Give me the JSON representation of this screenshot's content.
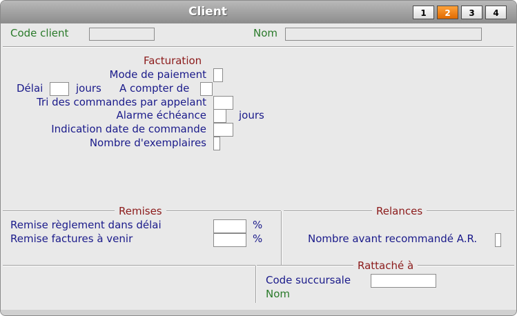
{
  "window": {
    "title": "Client"
  },
  "tabs": [
    {
      "label": "1",
      "active": false
    },
    {
      "label": "2",
      "active": true
    },
    {
      "label": "3",
      "active": false
    },
    {
      "label": "4",
      "active": false
    }
  ],
  "header": {
    "code_client_label": "Code client",
    "nom_label": "Nom",
    "code_client_value": "",
    "nom_value": ""
  },
  "facturation": {
    "title": "Facturation",
    "mode_paiement_label": "Mode de paiement",
    "delai_label": "Délai",
    "jours_label": "jours",
    "a_compter_label": "A compter de",
    "tri_commandes_label": "Tri des commandes par appelant",
    "alarme_label": "Alarme échéance",
    "alarme_jours_label": "jours",
    "indication_label": "Indication date de commande",
    "exemplaires_label": "Nombre d'exemplaires"
  },
  "remises": {
    "title": "Remises",
    "reglement_label": "Remise règlement dans délai",
    "factures_label": "Remise factures à venir",
    "percent_1": "%",
    "percent_2": "%"
  },
  "relances": {
    "title": "Relances",
    "recommande_label": "Nombre avant recommandé A.R."
  },
  "rattache": {
    "title": "Rattaché à",
    "succursale_label": "Code succursale",
    "nom_label": "Nom"
  },
  "colors": {
    "tab_active": "#f07a10",
    "label_navy": "#1a1a8a",
    "label_green": "#2a7a2a",
    "section_red": "#8b1a1a"
  }
}
